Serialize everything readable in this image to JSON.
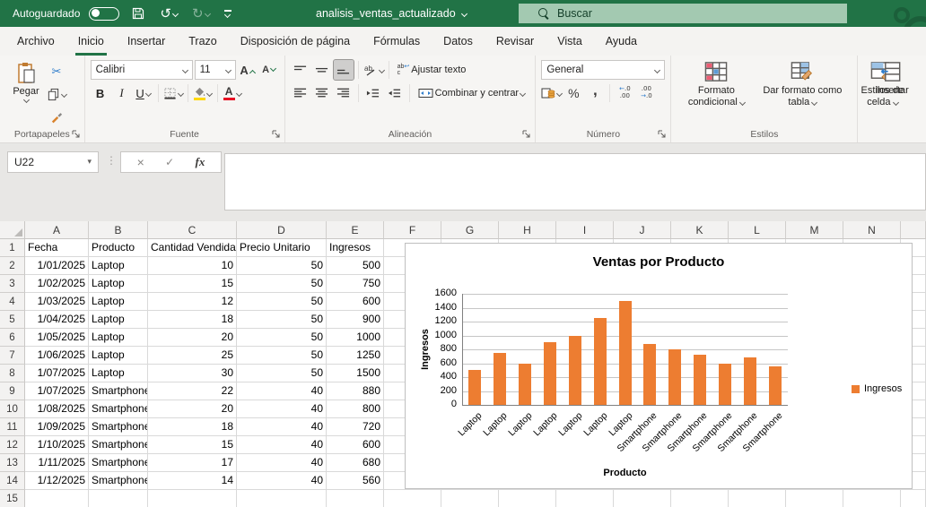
{
  "colors": {
    "excel_green": "#217346",
    "bar_orange": "#ED7D31",
    "search_fill": "#A3C9B1",
    "fill_yellow": "#FFD800",
    "font_red": "#E81123"
  },
  "titlebar": {
    "autosave": "Autoguardado",
    "filename": "analisis_ventas_actualizado",
    "search": "Buscar"
  },
  "tabs": {
    "items": [
      "Archivo",
      "Inicio",
      "Insertar",
      "Trazo",
      "Disposición de página",
      "Fórmulas",
      "Datos",
      "Revisar",
      "Vista",
      "Ayuda"
    ],
    "active": "Inicio"
  },
  "ribbon": {
    "paste": "Pegar",
    "font_name": "Calibri",
    "font_size": "11",
    "bold": "B",
    "italic": "I",
    "underline": "U",
    "wrap_text": "Ajustar texto",
    "merge_center": "Combinar y centrar",
    "number_format": "General",
    "percent": "%",
    "comma": ",",
    "cond_format": "Formato condicional",
    "format_table": "Dar formato como tabla",
    "cell_styles": "Estilos de celda",
    "insert": "Insertar",
    "groups": {
      "clipboard": "Portapapeles",
      "font": "Fuente",
      "alignment": "Alineación",
      "number": "Número",
      "styles": "Estilos"
    }
  },
  "formula_bar": {
    "name_box": "U22",
    "cancel": "×",
    "enter": "✓",
    "fx": "fx"
  },
  "sheet": {
    "col_headers": [
      "A",
      "B",
      "C",
      "D",
      "E",
      "F",
      "G",
      "H",
      "I",
      "J",
      "K",
      "L",
      "M",
      "N",
      ""
    ],
    "columns": [
      "Fecha",
      "Producto",
      "Cantidad Vendida",
      "Precio Unitario",
      "Ingresos"
    ],
    "rows": [
      [
        "1/01/2025",
        "Laptop",
        "10",
        "50",
        "500"
      ],
      [
        "1/02/2025",
        "Laptop",
        "15",
        "50",
        "750"
      ],
      [
        "1/03/2025",
        "Laptop",
        "12",
        "50",
        "600"
      ],
      [
        "1/04/2025",
        "Laptop",
        "18",
        "50",
        "900"
      ],
      [
        "1/05/2025",
        "Laptop",
        "20",
        "50",
        "1000"
      ],
      [
        "1/06/2025",
        "Laptop",
        "25",
        "50",
        "1250"
      ],
      [
        "1/07/2025",
        "Laptop",
        "30",
        "50",
        "1500"
      ],
      [
        "1/07/2025",
        "Smartphone",
        "22",
        "40",
        "880"
      ],
      [
        "1/08/2025",
        "Smartphone",
        "20",
        "40",
        "800"
      ],
      [
        "1/09/2025",
        "Smartphone",
        "18",
        "40",
        "720"
      ],
      [
        "1/10/2025",
        "Smartphone",
        "15",
        "40",
        "600"
      ],
      [
        "1/11/2025",
        "Smartphone",
        "17",
        "40",
        "680"
      ],
      [
        "1/12/2025",
        "Smartphone",
        "14",
        "40",
        "560"
      ]
    ]
  },
  "chart_data": {
    "type": "bar",
    "title": "Ventas por Producto",
    "xlabel": "Producto",
    "ylabel": "Ingresos",
    "categories": [
      "Laptop",
      "Laptop",
      "Laptop",
      "Laptop",
      "Laptop",
      "Laptop",
      "Laptop",
      "Smartphone",
      "Smartphone",
      "Smartphone",
      "Smartphone",
      "Smartphone",
      "Smartphone"
    ],
    "values": [
      500,
      750,
      600,
      900,
      1000,
      1250,
      1500,
      880,
      800,
      720,
      600,
      680,
      560
    ],
    "ylim": [
      0,
      1600
    ],
    "ytick_step": 200,
    "bar_color": "#ED7D31",
    "grid": true,
    "legend": [
      {
        "label": "Ingresos",
        "color": "#ED7D31"
      }
    ],
    "legend_position": "right"
  }
}
